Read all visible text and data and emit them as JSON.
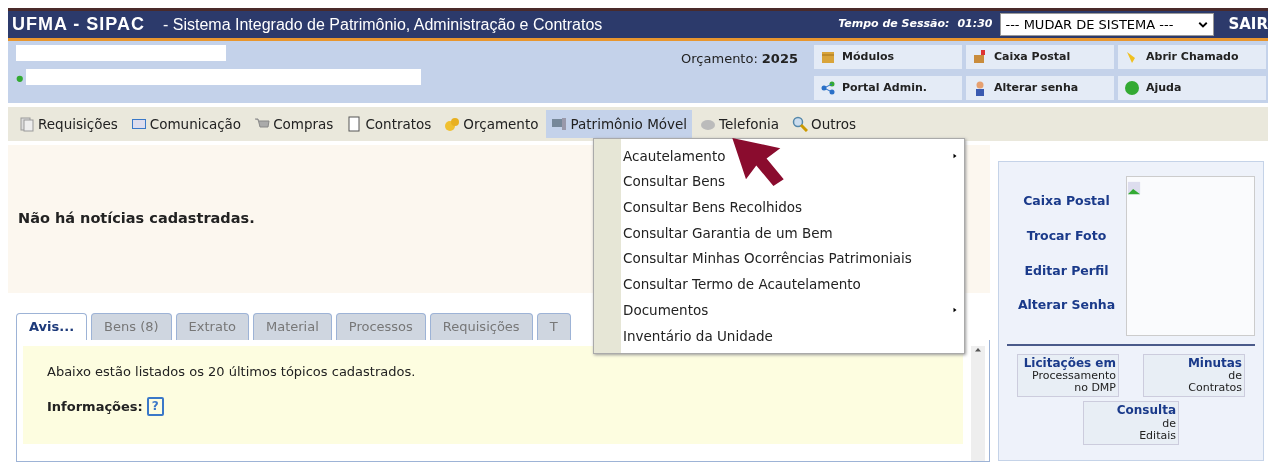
{
  "header": {
    "system": "UFMA - SIPAC",
    "subtitle": "- Sistema Integrado de Patrimônio, Administração e Contratos",
    "session_label": "Tempo de Sessão:",
    "session_time": "01:30",
    "system_select": "--- MUDAR DE SISTEMA ---",
    "logout": "SAIR"
  },
  "info": {
    "budget_label": "Orçamento:",
    "budget_year": "2025",
    "shortcuts": [
      {
        "label": "Módulos"
      },
      {
        "label": "Caixa Postal"
      },
      {
        "label": "Abrir Chamado"
      },
      {
        "label": "Portal Admin."
      },
      {
        "label": "Alterar senha"
      },
      {
        "label": "Ajuda"
      }
    ]
  },
  "menu": [
    {
      "label": "Requisições",
      "selected": false
    },
    {
      "label": "Comunicação",
      "selected": false
    },
    {
      "label": "Compras",
      "selected": false
    },
    {
      "label": "Contratos",
      "selected": false
    },
    {
      "label": "Orçamento",
      "selected": false
    },
    {
      "label": "Patrimônio Móvel",
      "selected": true
    },
    {
      "label": "Telefonia",
      "selected": false
    },
    {
      "label": "Outros",
      "selected": false
    }
  ],
  "submenu": [
    {
      "label": "Acautelamento",
      "has_submenu": true
    },
    {
      "label": "Consultar Bens",
      "has_submenu": false
    },
    {
      "label": "Consultar Bens Recolhidos",
      "has_submenu": false
    },
    {
      "label": "Consultar Garantia de um Bem",
      "has_submenu": false
    },
    {
      "label": "Consultar Minhas Ocorrências Patrimoniais",
      "has_submenu": false
    },
    {
      "label": "Consultar Termo de Acautelamento",
      "has_submenu": false
    },
    {
      "label": "Documentos",
      "has_submenu": true
    },
    {
      "label": "Inventário da Unidade",
      "has_submenu": false
    }
  ],
  "news": "Não há notícias cadastradas.",
  "tabs": [
    {
      "label": "Avis...",
      "selected": true
    },
    {
      "label": "Bens (8)",
      "selected": false
    },
    {
      "label": "Extrato",
      "selected": false
    },
    {
      "label": "Material",
      "selected": false
    },
    {
      "label": "Processos",
      "selected": false
    },
    {
      "label": "Requisições",
      "selected": false
    },
    {
      "label": "T",
      "selected": false
    }
  ],
  "notice": {
    "text": "Abaixo estão listados os 20 últimos tópicos cadastrados.",
    "info_label": "Informações:",
    "help": "?"
  },
  "profile_links": [
    "Caixa Postal",
    "Trocar Foto",
    "Editar Perfil",
    "Alterar Senha"
  ],
  "banners": [
    {
      "lines": [
        "Licitações em",
        "Processamento",
        "no DMP"
      ]
    },
    {
      "lines": [
        "Minutas",
        "de",
        "Contratos"
      ]
    },
    {
      "lines": [
        "Consulta",
        "de",
        "Editais"
      ]
    }
  ]
}
